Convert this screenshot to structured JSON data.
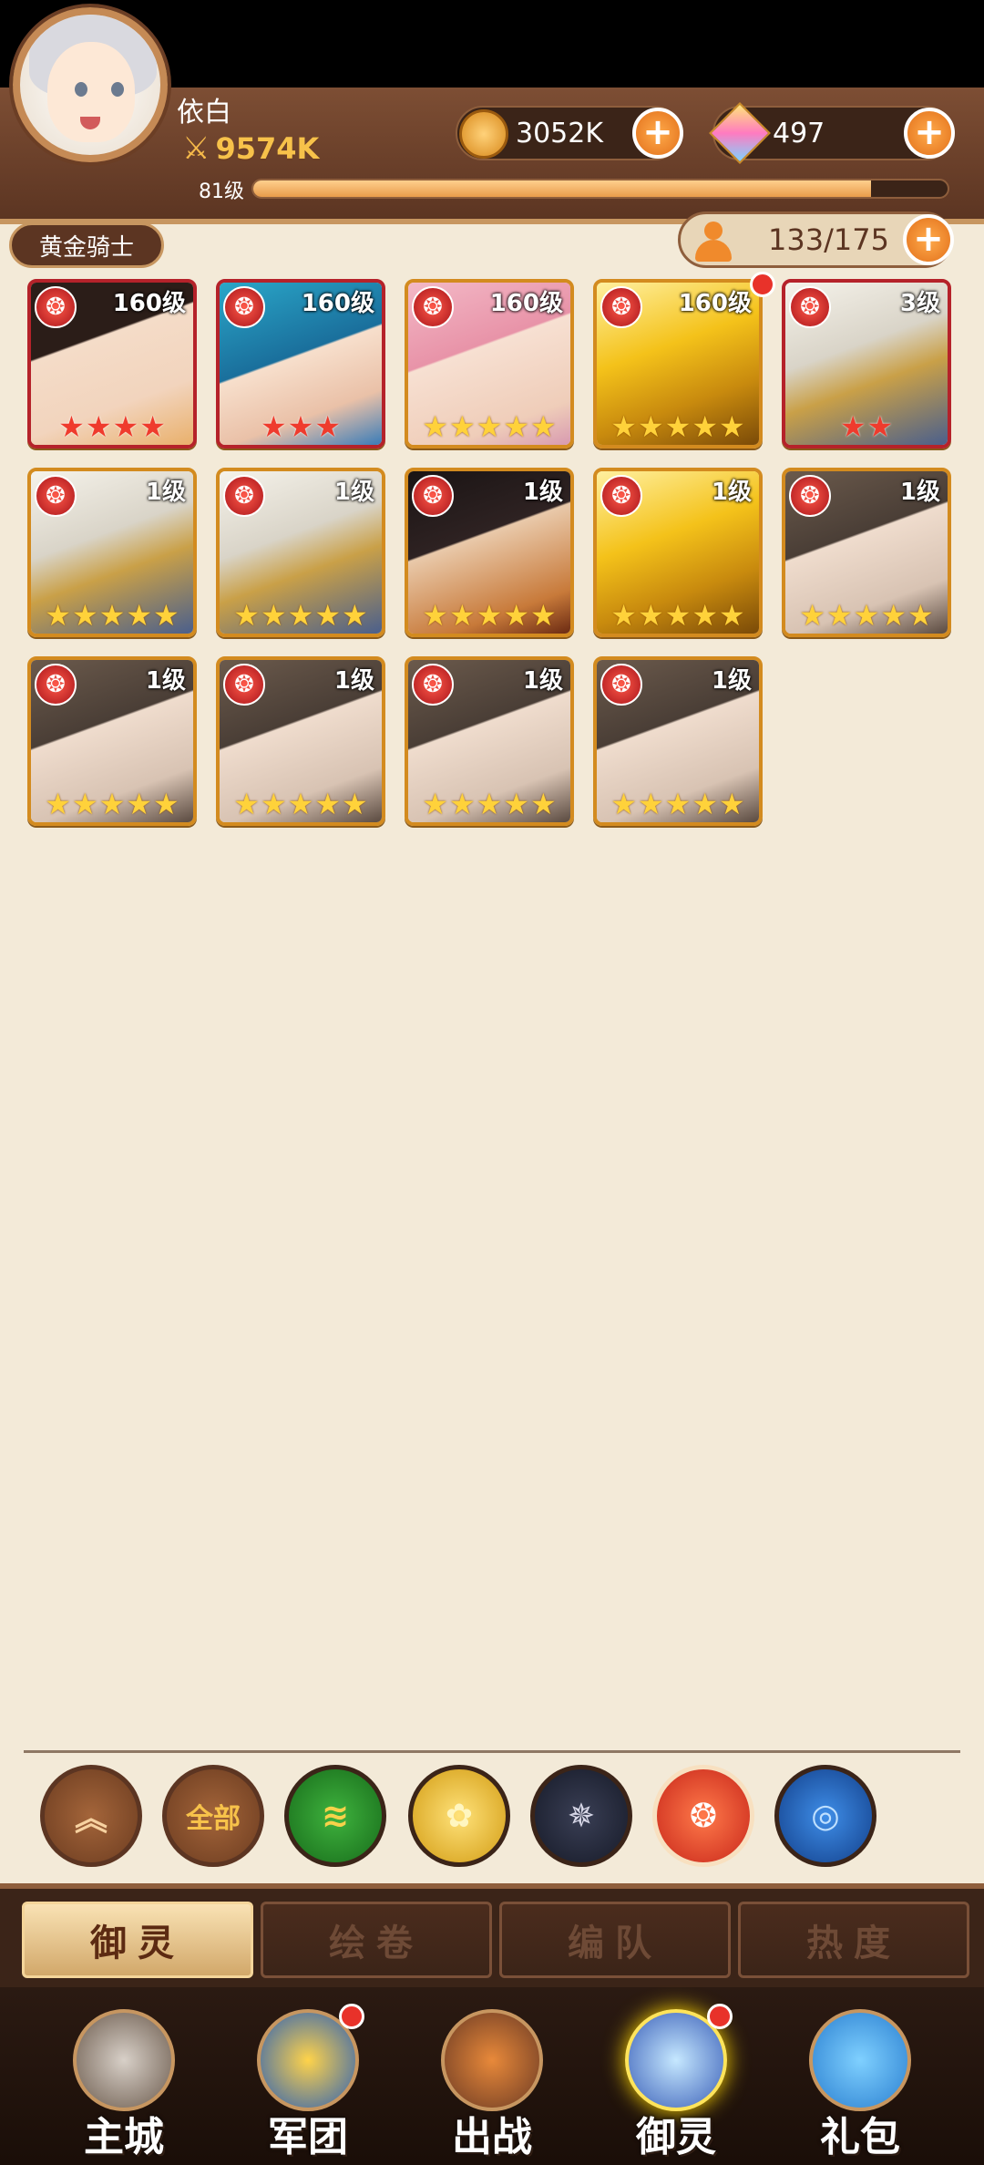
{
  "header": {
    "player_name": "依白",
    "power": "9574K",
    "level": "81级",
    "title": "黄金骑士",
    "exp_fraction": 0.89,
    "coins": "3052K",
    "gems": "497",
    "roster_count": "133/175"
  },
  "cards": [
    {
      "level": "160级",
      "stars": 4,
      "star_color": "red",
      "frame": "red",
      "art": "dark-hair-woman"
    },
    {
      "level": "160级",
      "stars": 3,
      "star_color": "red",
      "frame": "red",
      "art": "blue-hair-girl"
    },
    {
      "level": "160级",
      "stars": 5,
      "star_color": "gold",
      "frame": "gold",
      "art": "pink-hair-man"
    },
    {
      "level": "160级",
      "stars": 5,
      "star_color": "gold",
      "frame": "gold",
      "art": "golden-armor",
      "notify": true
    },
    {
      "level": "3级",
      "stars": 2,
      "star_color": "red",
      "frame": "red",
      "art": "white-gold-knight"
    },
    {
      "level": "1级",
      "stars": 5,
      "star_color": "gold",
      "frame": "gold",
      "art": "white-gold-knight"
    },
    {
      "level": "1级",
      "stars": 5,
      "star_color": "gold",
      "frame": "gold",
      "art": "white-gold-knight"
    },
    {
      "level": "1级",
      "stars": 5,
      "star_color": "gold",
      "frame": "gold",
      "art": "dark-warrior"
    },
    {
      "level": "1级",
      "stars": 5,
      "star_color": "gold",
      "frame": "gold",
      "art": "golden-armor"
    },
    {
      "level": "1级",
      "stars": 5,
      "star_color": "gold",
      "frame": "gold",
      "art": "crowned-woman"
    },
    {
      "level": "1级",
      "stars": 5,
      "star_color": "gold",
      "frame": "gold",
      "art": "crowned-woman"
    },
    {
      "level": "1级",
      "stars": 5,
      "star_color": "gold",
      "frame": "gold",
      "art": "crowned-woman"
    },
    {
      "level": "1级",
      "stars": 5,
      "star_color": "gold",
      "frame": "gold",
      "art": "crowned-woman"
    },
    {
      "level": "1级",
      "stars": 5,
      "star_color": "gold",
      "frame": "gold",
      "art": "crowned-woman"
    }
  ],
  "filters": {
    "all_label": "全部",
    "up_icon": "double-chevron-up-icon"
  },
  "tabs": [
    "御灵",
    "绘卷",
    "编队",
    "热度"
  ],
  "nav": [
    {
      "label": "主城",
      "icon": "angel-statue-icon",
      "notify": false
    },
    {
      "label": "军团",
      "icon": "fist-shield-icon",
      "notify": true
    },
    {
      "label": "出战",
      "icon": "sword-gate-icon",
      "notify": false
    },
    {
      "label": "御灵",
      "icon": "crystal-icon",
      "notify": true,
      "active": true
    },
    {
      "label": "礼包",
      "icon": "shop-stall-icon",
      "notify": false
    }
  ],
  "colors": {
    "accent_orange": "#e2701a",
    "frame_gold": "#d38b1f",
    "frame_red": "#b5222a",
    "header_brown": "#5c3522"
  }
}
